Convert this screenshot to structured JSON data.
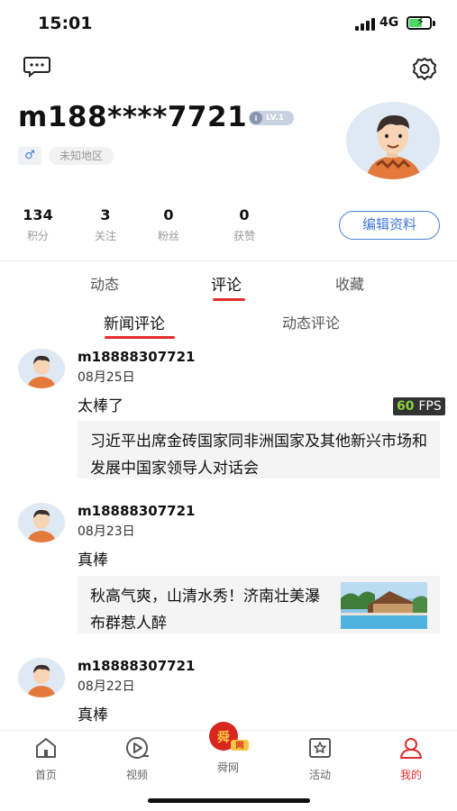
{
  "status_bar": {
    "time": "15:01",
    "network": "4G"
  },
  "profile": {
    "username": "m188****7721",
    "level": "LV.1",
    "gender_symbol": "♂",
    "region": "未知地区",
    "stats": [
      {
        "value": "134",
        "label": "积分"
      },
      {
        "value": "3",
        "label": "关注"
      },
      {
        "value": "0",
        "label": "粉丝"
      },
      {
        "value": "0",
        "label": "获赞"
      }
    ],
    "edit_button": "编辑资料"
  },
  "tabs": [
    {
      "label": "动态",
      "active": false
    },
    {
      "label": "评论",
      "active": true
    },
    {
      "label": "收藏",
      "active": false
    }
  ],
  "subtabs": [
    {
      "label": "新闻评论",
      "active": true
    },
    {
      "label": "动态评论",
      "active": false
    }
  ],
  "comments": [
    {
      "user": "m18888307721",
      "date": "08月25日",
      "text": "太棒了",
      "news_title": "习近平出席金砖国家同非洲国家及其他新兴市场和发展中国家领导人对话会",
      "has_thumb": false
    },
    {
      "user": "m18888307721",
      "date": "08月23日",
      "text": "真棒",
      "news_title": "秋高气爽，山清水秀！济南壮美瀑布群惹人醉",
      "has_thumb": true
    },
    {
      "user": "m18888307721",
      "date": "08月22日",
      "text": "真棒"
    }
  ],
  "fps_overlay": {
    "value": "60",
    "unit": "FPS"
  },
  "tabbar": [
    {
      "label": "首页",
      "icon": "home-icon"
    },
    {
      "label": "视频",
      "icon": "video-icon"
    },
    {
      "label": "舜网",
      "icon": "brand-logo-icon"
    },
    {
      "label": "活动",
      "icon": "star-flag-icon"
    },
    {
      "label": "我的",
      "icon": "profile-icon",
      "active": true
    }
  ],
  "colors": {
    "accent": "#e22d2d",
    "link_blue": "#3f78d3",
    "active_tab": "#e22d2d"
  }
}
